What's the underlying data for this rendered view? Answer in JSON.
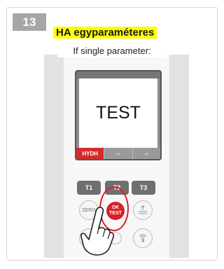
{
  "step": {
    "number": "13"
  },
  "title": "HA egyparaméteres",
  "subtitle": "If single parameter:",
  "display": {
    "main_text": "TEST",
    "bar": [
      {
        "label": "HYDH",
        "color": "#d62b2b"
      },
      {
        "label": "--",
        "color": "#9a9a9a"
      },
      {
        "label": "--",
        "color": "#9a9a9a"
      }
    ]
  },
  "buttons": {
    "t1": "T1",
    "t2": "T2",
    "t3": "T3",
    "zero": "ZERO",
    "ok_line1": "OK",
    "ok_line2": "TEST"
  },
  "colors": {
    "accent": "#d91f2b",
    "highlight": "#ffff00"
  }
}
